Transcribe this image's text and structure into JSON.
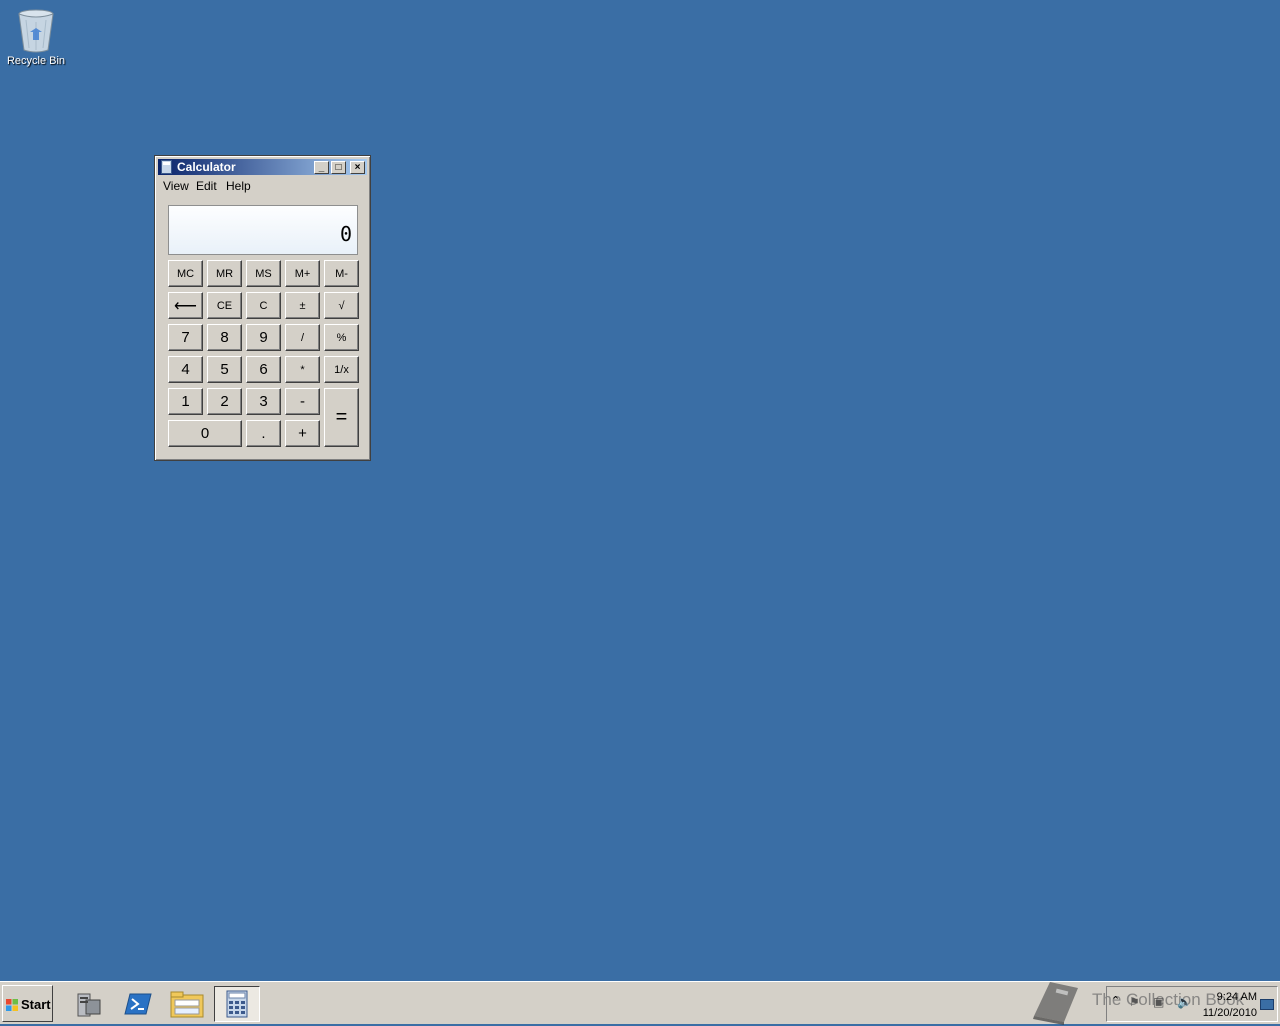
{
  "desktop": {
    "recycle_bin_label": "Recycle Bin",
    "background_color": "#3a6ea5"
  },
  "calculator": {
    "title": "Calculator",
    "title_buttons": [
      "_",
      "□",
      "×"
    ],
    "menu": [
      "View",
      "Edit",
      "Help"
    ],
    "display_value": "0",
    "keys": {
      "mc": "MC",
      "mr": "MR",
      "ms": "MS",
      "mplus": "M+",
      "mminus": "M-",
      "backspace": "⟵",
      "ce": "CE",
      "c": "C",
      "plusminus": "±",
      "sqrt": "√",
      "k7": "7",
      "k8": "8",
      "k9": "9",
      "div": "/",
      "pct": "%",
      "k4": "4",
      "k5": "5",
      "k6": "6",
      "mul": "*",
      "recip": "1/x",
      "k1": "1",
      "k2": "2",
      "k3": "3",
      "sub": "-",
      "eq": "=",
      "k0": "0",
      "dot": ".",
      "add": "+"
    }
  },
  "taskbar": {
    "start_label": "Start",
    "apps": [
      "server-manager-icon",
      "powershell-icon",
      "explorer-icon",
      "calculator-icon"
    ],
    "clock_time": "9:24 AM",
    "clock_date": "11/20/2010",
    "watermark": "The Collection Book"
  }
}
